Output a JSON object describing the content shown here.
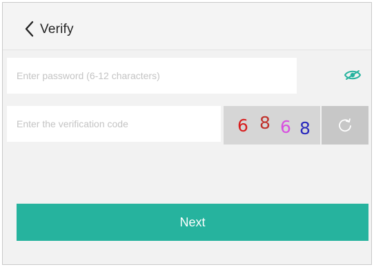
{
  "header": {
    "title": "Verify",
    "back_icon": "chevron-left-icon"
  },
  "form": {
    "password_placeholder": "Enter password (6-12 characters)",
    "password_toggle_icon": "eye-icon",
    "captcha_placeholder": "Enter the verification code",
    "captcha": {
      "chars": [
        "6",
        "8",
        "6",
        "8"
      ],
      "colors": [
        "#d81e1e",
        "#c0302a",
        "#d84fe0",
        "#2b2bbd"
      ]
    },
    "refresh_icon": "refresh-icon",
    "next_label": "Next"
  },
  "colors": {
    "accent": "#26b39e"
  }
}
